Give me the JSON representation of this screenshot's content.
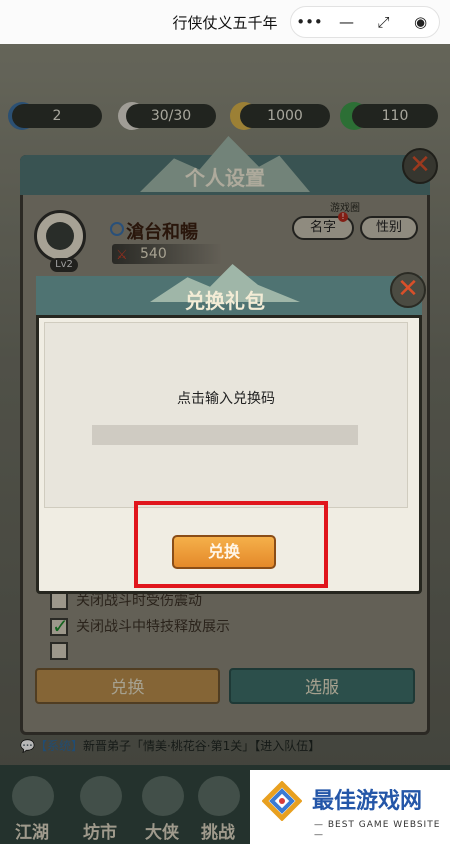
{
  "topbar": {
    "title": "行侠仗义五千年",
    "more_icon": "•••",
    "minimize_icon": "—",
    "restore_icon": "⤢",
    "close_icon": "◉"
  },
  "stats": {
    "level": "2",
    "stamina": "30/30",
    "gold": "1000",
    "jade": "110"
  },
  "settings": {
    "title": "个人设置",
    "close_label": "✕",
    "player_name": "滄台和暢",
    "level_badge": "Lv2",
    "power": "540",
    "ugc_label": "游戏圈",
    "name_button": "名字",
    "name_badge": "!",
    "gender_button": "性别",
    "options": [
      {
        "label": "关闭战斗时受伤震动",
        "checked": false
      },
      {
        "label": "关闭战斗中特技释放展示",
        "checked": true
      }
    ],
    "redeem_button": "兑换",
    "select_server_button": "选服"
  },
  "chat": {
    "channel": "【系统】",
    "message": "新晋弟子「情美·桃花谷·第1关」【进入队伍】"
  },
  "nav": [
    "江湖",
    "坊市",
    "大侠",
    "挑战"
  ],
  "redeem_dialog": {
    "title": "兑换礼包",
    "close_label": "✕",
    "prompt": "点击输入兑换码",
    "input_value": "",
    "input_placeholder": "",
    "exchange_button": "兑换"
  },
  "watermark": {
    "title": "最佳游戏网",
    "subtitle": "— BEST GAME WEBSITE —"
  },
  "colors": {
    "header_teal": "#4f7372",
    "highlight_red": "#e0151c",
    "exchange_orange": "#f0a43c",
    "watermark_blue": "#2456a8"
  }
}
